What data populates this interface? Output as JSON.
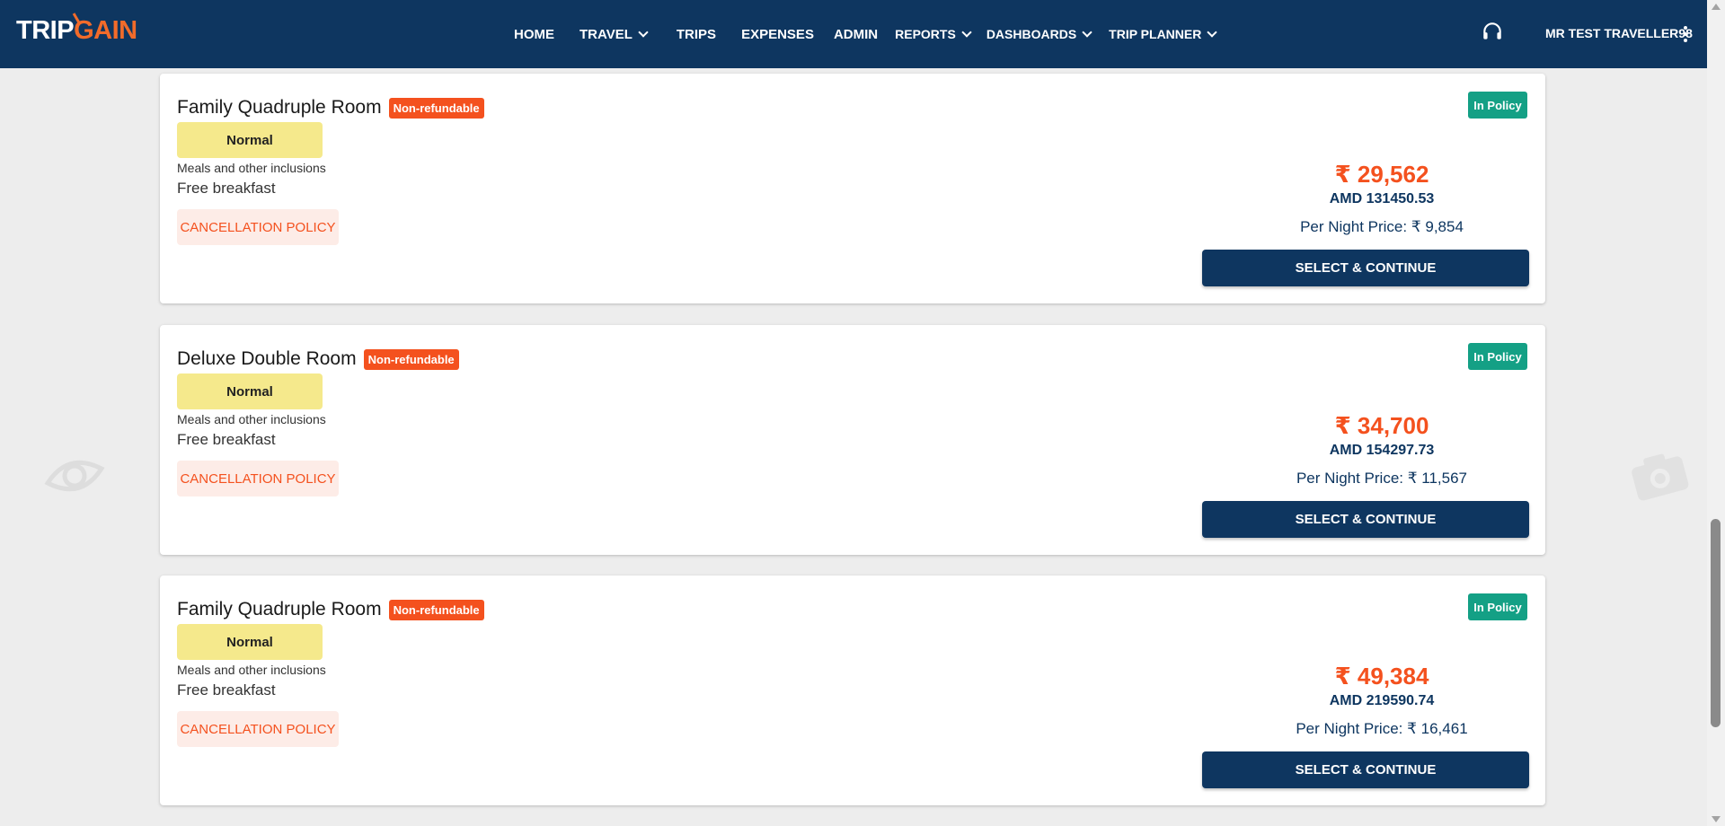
{
  "brand": {
    "logo_part1": "TRIP",
    "logo_part2": "GAIN"
  },
  "nav": {
    "items": [
      {
        "label": "HOME",
        "has_dropdown": false
      },
      {
        "label": "TRAVEL",
        "has_dropdown": true
      },
      {
        "label": "TRIPS",
        "has_dropdown": false
      },
      {
        "label": "EXPENSES",
        "has_dropdown": false
      },
      {
        "label": "ADMIN",
        "has_dropdown": false
      },
      {
        "label": "REPORTS",
        "has_dropdown": true
      },
      {
        "label": "DASHBOARDS",
        "has_dropdown": true
      },
      {
        "label": "TRIP PLANNER",
        "has_dropdown": true
      }
    ],
    "user_name": "MR TEST TRAVELLER98",
    "support_icon": "headset-icon",
    "menu_icon": "kebab-menu-icon"
  },
  "rooms": [
    {
      "name": "Family Quadruple Room",
      "refund_badge": "Non-refundable",
      "tag": "Normal",
      "meals_label": "Meals and other inclusions",
      "meal": "Free breakfast",
      "cancellation_label": "CANCELLATION POLICY",
      "policy_badge": "In Policy",
      "price_inr": "₹ 29,562",
      "price_amd": "AMD 131450.53",
      "per_night": "Per Night Price: ₹ 9,854",
      "select_label": "SELECT & CONTINUE"
    },
    {
      "name": "Deluxe Double Room",
      "refund_badge": "Non-refundable",
      "tag": "Normal",
      "meals_label": "Meals and other inclusions",
      "meal": "Free breakfast",
      "cancellation_label": "CANCELLATION POLICY",
      "policy_badge": "In Policy",
      "price_inr": "₹ 34,700",
      "price_amd": "AMD 154297.73",
      "per_night": "Per Night Price: ₹ 11,567",
      "select_label": "SELECT & CONTINUE"
    },
    {
      "name": "Family Quadruple Room",
      "refund_badge": "Non-refundable",
      "tag": "Normal",
      "meals_label": "Meals and other inclusions",
      "meal": "Free breakfast",
      "cancellation_label": "CANCELLATION POLICY",
      "policy_badge": "In Policy",
      "price_inr": "₹ 49,384",
      "price_amd": "AMD 219590.74",
      "per_night": "Per Night Price: ₹ 16,461",
      "select_label": "SELECT & CONTINUE"
    }
  ],
  "colors": {
    "header_bg": "#0e3660",
    "accent_orange": "#f4511e",
    "policy_green": "#14a085",
    "tag_yellow": "#f5e98c",
    "page_bg": "#ededed"
  }
}
